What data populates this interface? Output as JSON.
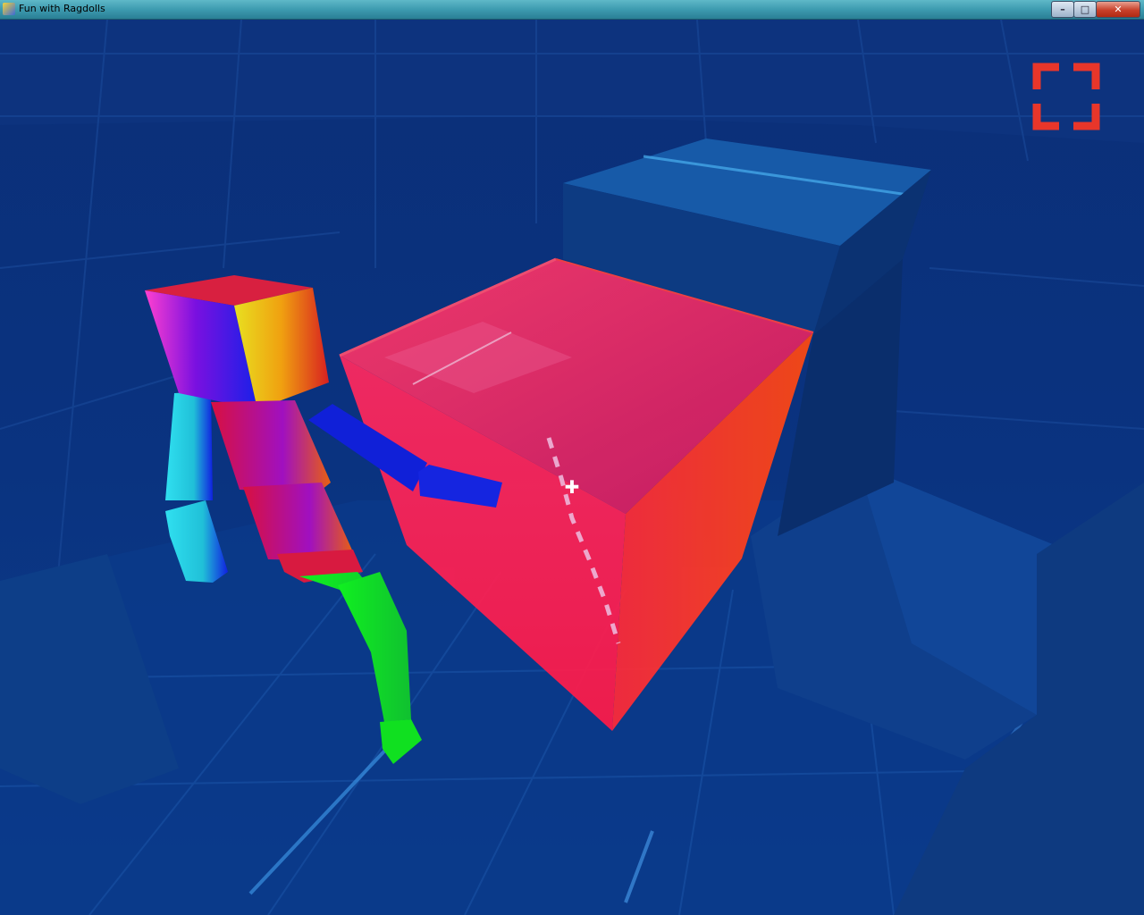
{
  "window": {
    "title": "Fun with Ragdolls",
    "controls": {
      "minimize": "–",
      "maximize": "□",
      "close": "✕"
    }
  },
  "hud": {
    "crosshair": "✚",
    "fullscreen_icon": "fullscreen-corners-icon"
  },
  "colors": {
    "background": "#0a2a6a",
    "cube": "#ff2050",
    "hud_accent": "#e8362a"
  }
}
